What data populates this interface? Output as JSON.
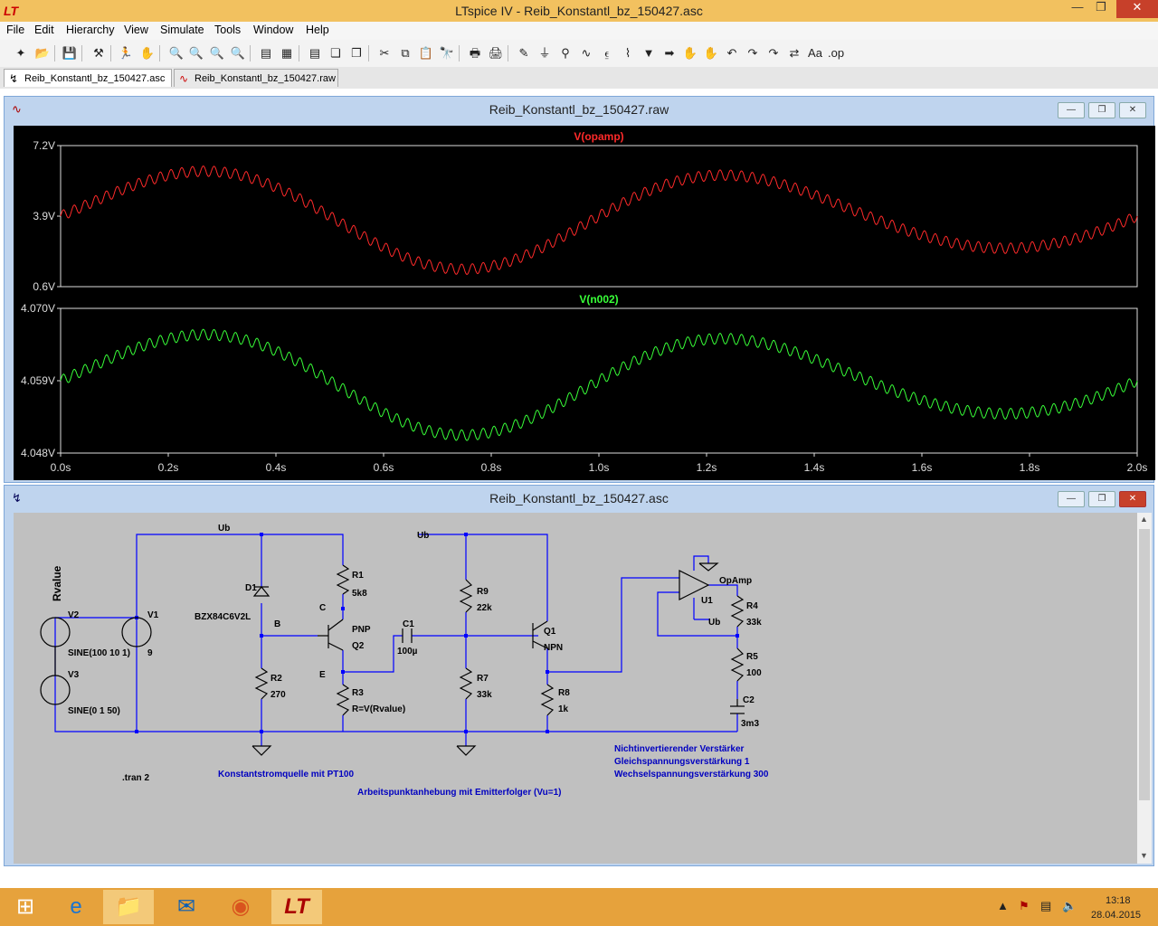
{
  "window": {
    "title": "LTspice IV - Reib_Konstantl_bz_150427.asc"
  },
  "menu": [
    "File",
    "Edit",
    "Hierarchy",
    "View",
    "Simulate",
    "Tools",
    "Window",
    "Help"
  ],
  "tabs": [
    {
      "label": "Reib_Konstantl_bz_150427.asc",
      "active": true
    },
    {
      "label": "Reib_Konstantl_bz_150427.raw",
      "active": false
    }
  ],
  "waveform_window": {
    "title": "Reib_Konstantl_bz_150427.raw"
  },
  "schematic_window": {
    "title": "Reib_Konstantl_bz_150427.asc"
  },
  "chart_data": [
    {
      "type": "line",
      "series": [
        {
          "name": "V(opamp)",
          "color": "#ff2a2a"
        }
      ],
      "ylim": [
        0.6,
        7.2
      ],
      "yticks": [
        "7.2V",
        "3.9V",
        "0.6V"
      ],
      "xlim": [
        0,
        2.0
      ],
      "grid": false,
      "description_values": {
        "offset": 3.9,
        "amplitude_slow": 2.5,
        "amplitude_ripple": 0.3,
        "freq_slow_hz": 1,
        "ripple_cycles": 150
      }
    },
    {
      "type": "line",
      "series": [
        {
          "name": "V(n002)",
          "color": "#38ff38"
        }
      ],
      "ylim": [
        4.048,
        4.07
      ],
      "yticks": [
        "4.070V",
        "4.059V",
        "4.048V"
      ],
      "xlim": [
        0,
        2.0
      ],
      "xticks": [
        "0.0s",
        "0.2s",
        "0.4s",
        "0.6s",
        "0.8s",
        "1.0s",
        "1.2s",
        "1.4s",
        "1.6s",
        "1.8s",
        "2.0s"
      ],
      "grid": false
    }
  ],
  "schematic": {
    "net_labels": {
      "ub1": "Ub",
      "ub2": "Ub",
      "ub3": "Ub",
      "b": "B",
      "c": "C",
      "e": "E",
      "rvalue": "Rvalue"
    },
    "components": {
      "v2": {
        "name": "V2",
        "value": "SINE(100 10 1)"
      },
      "v3": {
        "name": "V3",
        "value": "SINE(0 1 50)"
      },
      "v1": {
        "name": "V1",
        "value": "9"
      },
      "d1": {
        "name": "D1",
        "value": "BZX84C6V2L"
      },
      "r1": {
        "name": "R1",
        "value": "5k8"
      },
      "r2": {
        "name": "R2",
        "value": "270"
      },
      "r3": {
        "name": "R3",
        "value": "R=V(Rvalue)"
      },
      "q2": {
        "name": "Q2",
        "value": "PNP"
      },
      "c1": {
        "name": "C1",
        "value": "100µ"
      },
      "r9": {
        "name": "R9",
        "value": "22k"
      },
      "r7": {
        "name": "R7",
        "value": "33k"
      },
      "q1": {
        "name": "Q1",
        "value": "NPN"
      },
      "r8": {
        "name": "R8",
        "value": "1k"
      },
      "u1": {
        "name": "U1",
        "value": "OpAmp"
      },
      "r4": {
        "name": "R4",
        "value": "33k"
      },
      "r5": {
        "name": "R5",
        "value": "100"
      },
      "c2": {
        "name": "C2",
        "value": "3m3"
      }
    },
    "directive": ".tran 2",
    "comments": {
      "konstant": "Konstantstromquelle mit PT100",
      "arbeits": "Arbeitspunktanhebung mit Emitterfolger (Vu=1)",
      "nicht1": "Nichtinvertierender Verstärker",
      "nicht2": "Gleichspannungsverstärkung 1",
      "nicht3": "Wechselspannungsverstärkung 300"
    },
    "colors": {
      "wire": "#0000ff",
      "text_comment": "#0000c0",
      "background": "#c0c0c0"
    }
  },
  "tray": {
    "time": "13:18",
    "date": "28.04.2015"
  }
}
